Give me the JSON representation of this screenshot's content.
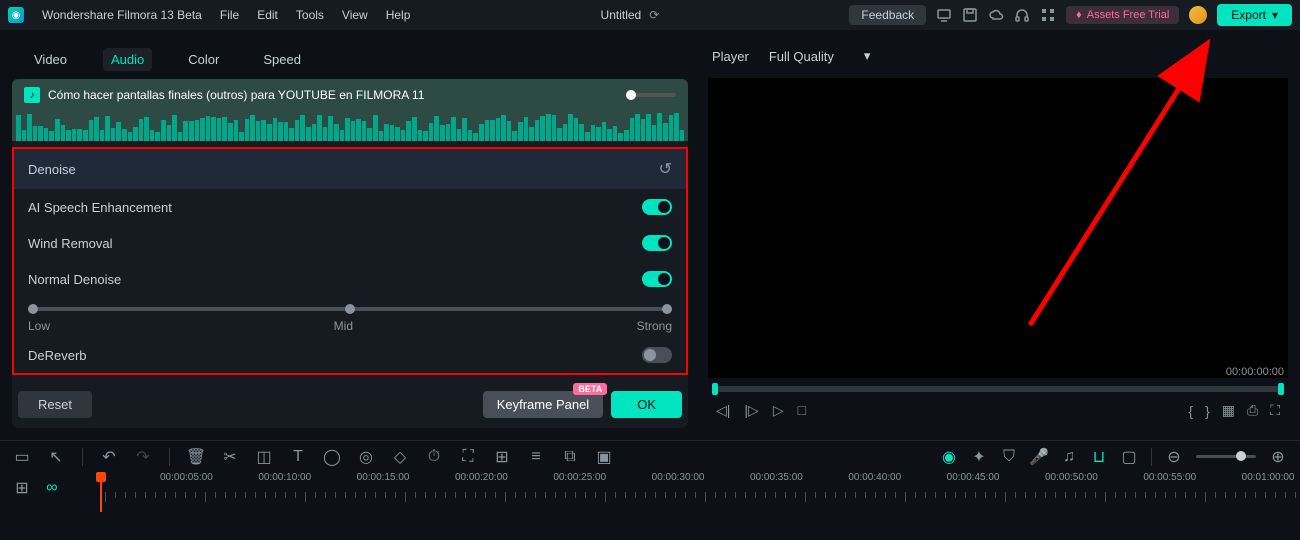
{
  "app": {
    "title": "Wondershare Filmora 13 Beta",
    "menus": [
      "File",
      "Edit",
      "Tools",
      "View",
      "Help"
    ],
    "document": "Untitled"
  },
  "topbar": {
    "feedback": "Feedback",
    "assets": "Assets Free Trial",
    "export": "Export"
  },
  "tabs": {
    "items": [
      "Video",
      "Audio",
      "Color",
      "Speed"
    ],
    "active": "Audio"
  },
  "clip": {
    "title": "Cómo hacer pantallas finales (outros) para YOUTUBE en FILMORA 11"
  },
  "denoise": {
    "header": "Denoise",
    "ai_speech": "AI Speech Enhancement",
    "wind": "Wind Removal",
    "normal": "Normal Denoise",
    "slider": {
      "low": "Low",
      "mid": "Mid",
      "strong": "Strong"
    },
    "dereverb": "DeReverb"
  },
  "buttons": {
    "reset": "Reset",
    "keyframe": "Keyframe Panel",
    "beta": "BETA",
    "ok": "OK"
  },
  "player": {
    "label": "Player",
    "quality": "Full Quality",
    "time": "00:00:00:00"
  },
  "timeline": {
    "marks": [
      "00:00:05:00",
      "00:00:10:00",
      "00:00:15:00",
      "00:00:20:00",
      "00:00:25:00",
      "00:00:30:00",
      "00:00:35:00",
      "00:00:40:00",
      "00:00:45:00",
      "00:00:50:00",
      "00:00:55:00",
      "00:01:00:00"
    ]
  }
}
